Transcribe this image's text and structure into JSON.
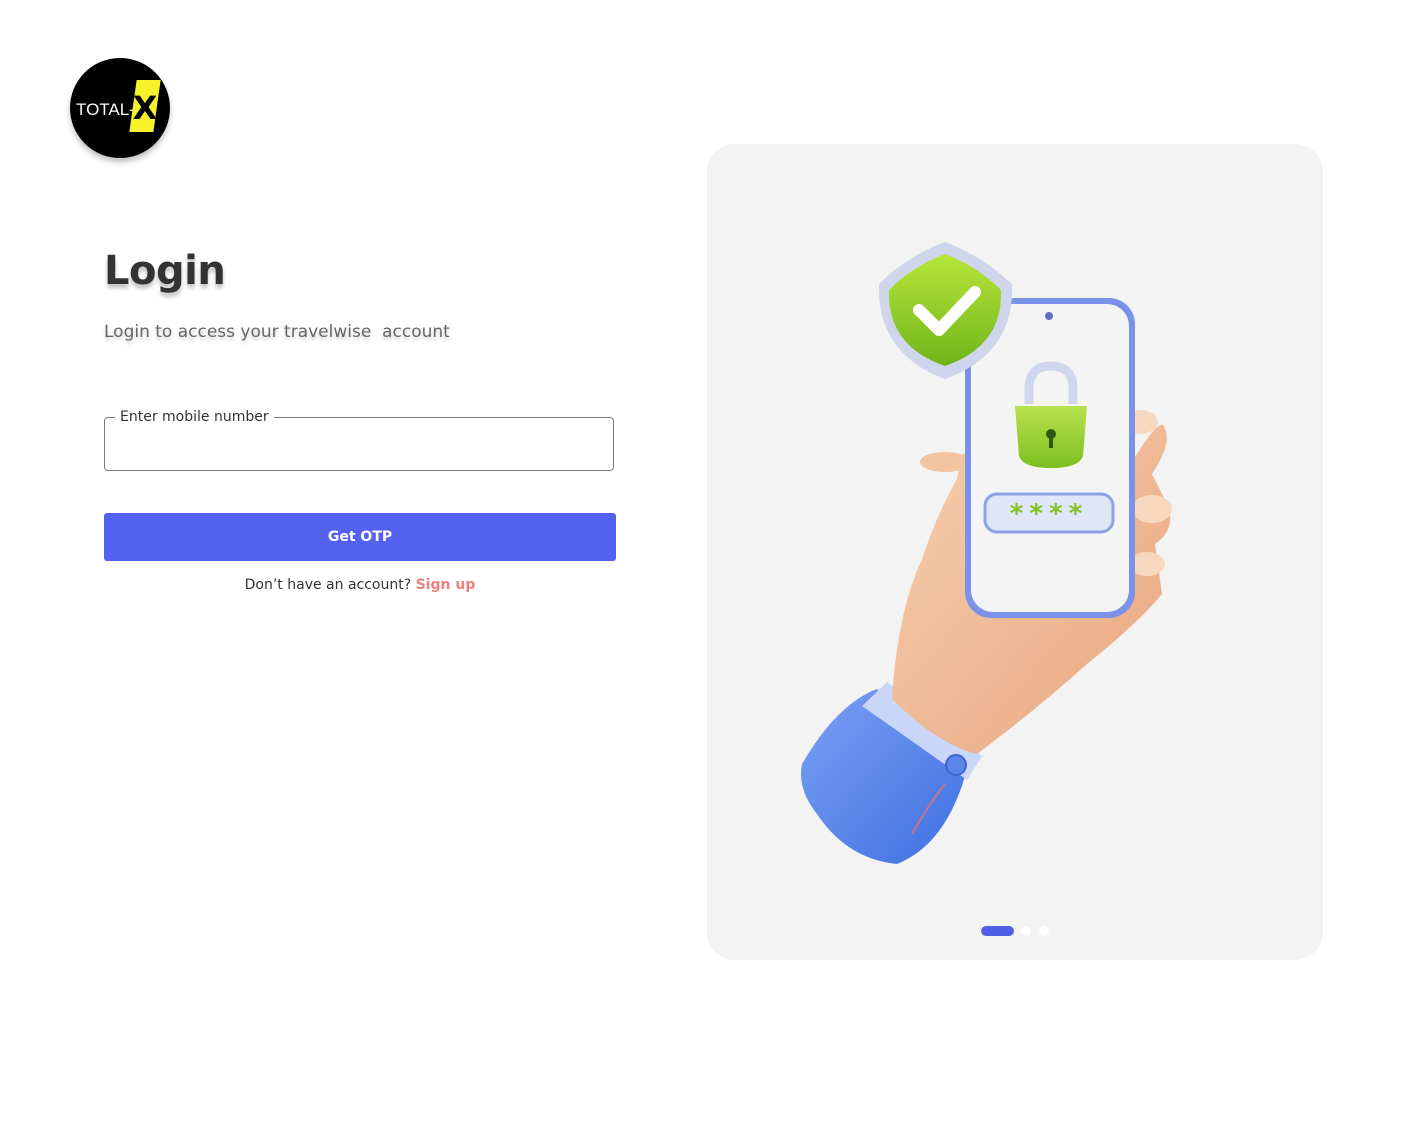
{
  "brand": {
    "logo_text": "TOTAL-",
    "logo_mark": "X"
  },
  "login": {
    "title": "Login",
    "subtitle": "Login to access your travelwise  account",
    "mobile_label": "Enter mobile number",
    "mobile_value": "",
    "otp_button": "Get OTP",
    "no_account_text": "Don’t have an account?",
    "signup_link": "Sign up"
  },
  "carousel": {
    "illustration": "hand-holding-phone-with-shield-lock-password",
    "password_mask": "****",
    "active_slide": 1,
    "total_slides": 3
  },
  "colors": {
    "primary": "#5360f0",
    "link": "#f07e7e",
    "panel_bg": "#f3f3f3",
    "logo_accent": "#f7f32a"
  }
}
